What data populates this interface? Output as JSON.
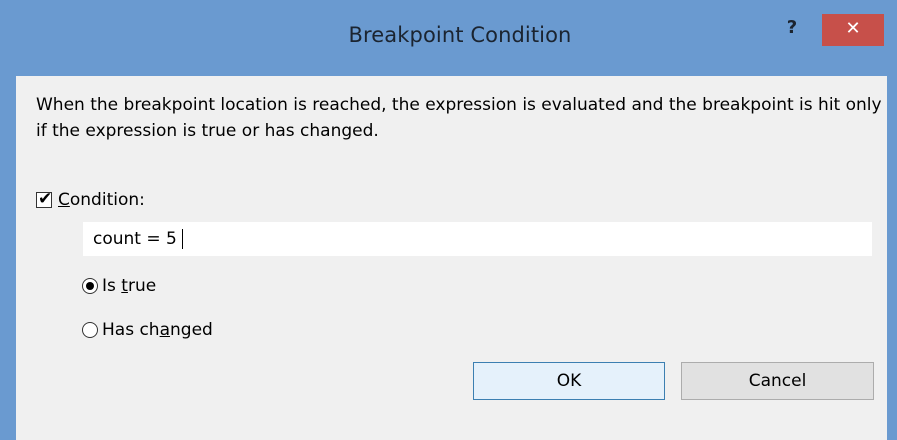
{
  "window": {
    "title": "Breakpoint Condition",
    "help_label": "?",
    "close_label": "✕"
  },
  "description": "When the breakpoint location is reached, the expression is evaluated and the breakpoint is hit only if the expression is true or has changed.",
  "condition": {
    "checked": true,
    "label_mnemonic": "C",
    "label_rest": "ondition:",
    "value": "count = 5"
  },
  "options": {
    "is_true": {
      "selected": true,
      "prefix": "Is ",
      "mnemonic": "t",
      "suffix": "rue"
    },
    "has_changed": {
      "selected": false,
      "prefix": "Has ch",
      "mnemonic": "a",
      "suffix": "nged"
    }
  },
  "buttons": {
    "ok_label": "OK",
    "cancel_label": "Cancel"
  },
  "colors": {
    "titlebar": "#6a9ad0",
    "close_button": "#c7504a",
    "client_background": "#f0f0f0"
  }
}
